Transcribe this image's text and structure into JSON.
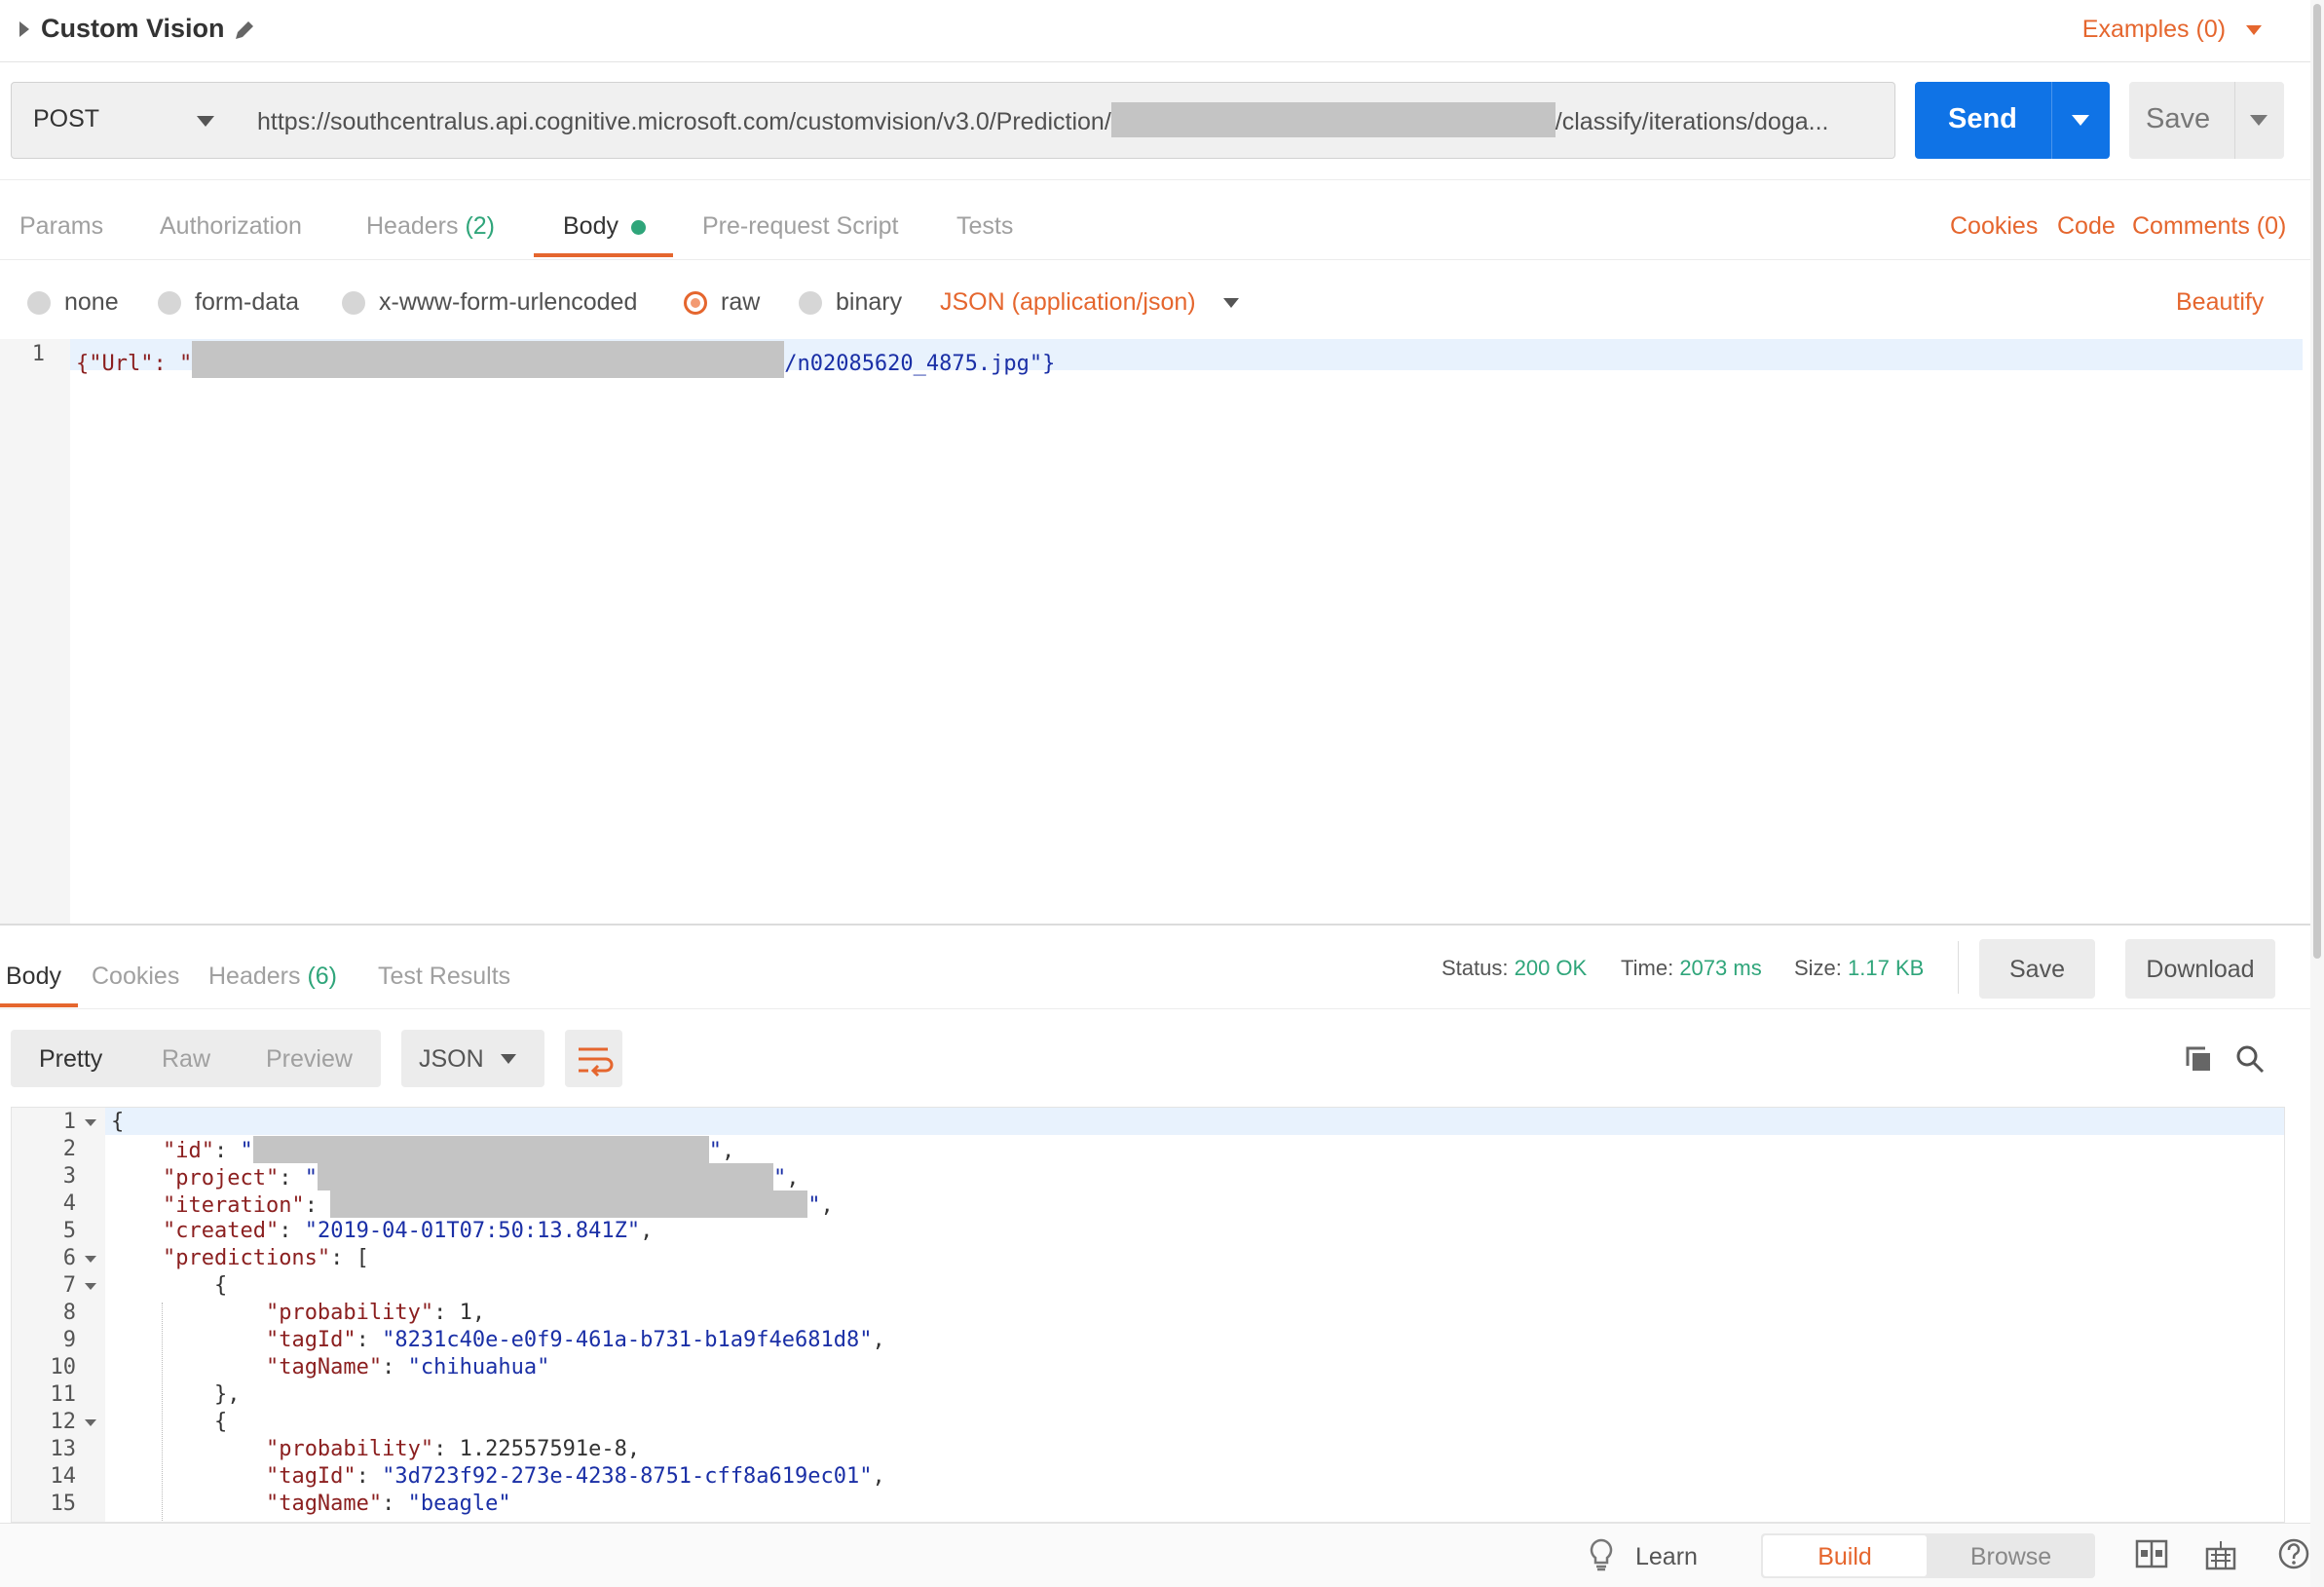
{
  "request": {
    "title": "Custom Vision",
    "examples": "Examples (0)",
    "method": "POST",
    "url_prefix": "https://southcentralus.api.cognitive.microsoft.com/customvision/v3.0/Prediction/",
    "url_suffix": "/classify/iterations/doga...",
    "send_label": "Send",
    "save_label": "Save"
  },
  "req_tabs": {
    "params": "Params",
    "authorization": "Authorization",
    "headers": "Headers",
    "headers_count": "(2)",
    "body": "Body",
    "prerequest": "Pre-request Script",
    "tests": "Tests",
    "cookies": "Cookies",
    "code": "Code",
    "comments": "Comments (0)"
  },
  "body_modes": {
    "none": "none",
    "form_data": "form-data",
    "urlencoded": "x-www-form-urlencoded",
    "raw": "raw",
    "binary": "binary",
    "content_type": "JSON (application/json)",
    "beautify": "Beautify"
  },
  "request_body": {
    "line_number": "1",
    "prefix": "{\"Url\": \"",
    "suffix": "/n02085620_4875.jpg\"}"
  },
  "response": {
    "tabs": {
      "body": "Body",
      "cookies": "Cookies",
      "headers": "Headers",
      "headers_count": "(6)",
      "test_results": "Test Results"
    },
    "status_label": "Status:",
    "status_value": "200 OK",
    "time_label": "Time:",
    "time_value": "2073 ms",
    "size_label": "Size:",
    "size_value": "1.17 KB",
    "save_label": "Save",
    "download_label": "Download",
    "view_modes": {
      "pretty": "Pretty",
      "raw": "Raw",
      "preview": "Preview"
    },
    "format": "JSON",
    "lines": {
      "l1": "{",
      "l2_key": "\"id\"",
      "l3_key": "\"project\"",
      "l4_key": "\"iteration\"",
      "l5_key": "\"created\"",
      "l5_val": "\"2019-04-01T07:50:13.841Z\"",
      "l6_key": "\"predictions\"",
      "l7": "{",
      "l8_key": "\"probability\"",
      "l8_val": "1",
      "l9_key": "\"tagId\"",
      "l9_val": "\"8231c40e-e0f9-461a-b731-b1a9f4e681d8\"",
      "l10_key": "\"tagName\"",
      "l10_val": "\"chihuahua\"",
      "l11": "},",
      "l12": "{",
      "l13_key": "\"probability\"",
      "l13_val": "1.22557591e-8",
      "l14_key": "\"tagId\"",
      "l14_val": "\"3d723f92-273e-4238-8751-cff8a619ec01\"",
      "l15_key": "\"tagName\"",
      "l15_val": "\"beagle\""
    }
  },
  "footer": {
    "learn": "Learn",
    "build": "Build",
    "browse": "Browse"
  },
  "colors": {
    "accent": "#e5662e",
    "primary": "#0f73e6",
    "success": "#2fa57a"
  }
}
